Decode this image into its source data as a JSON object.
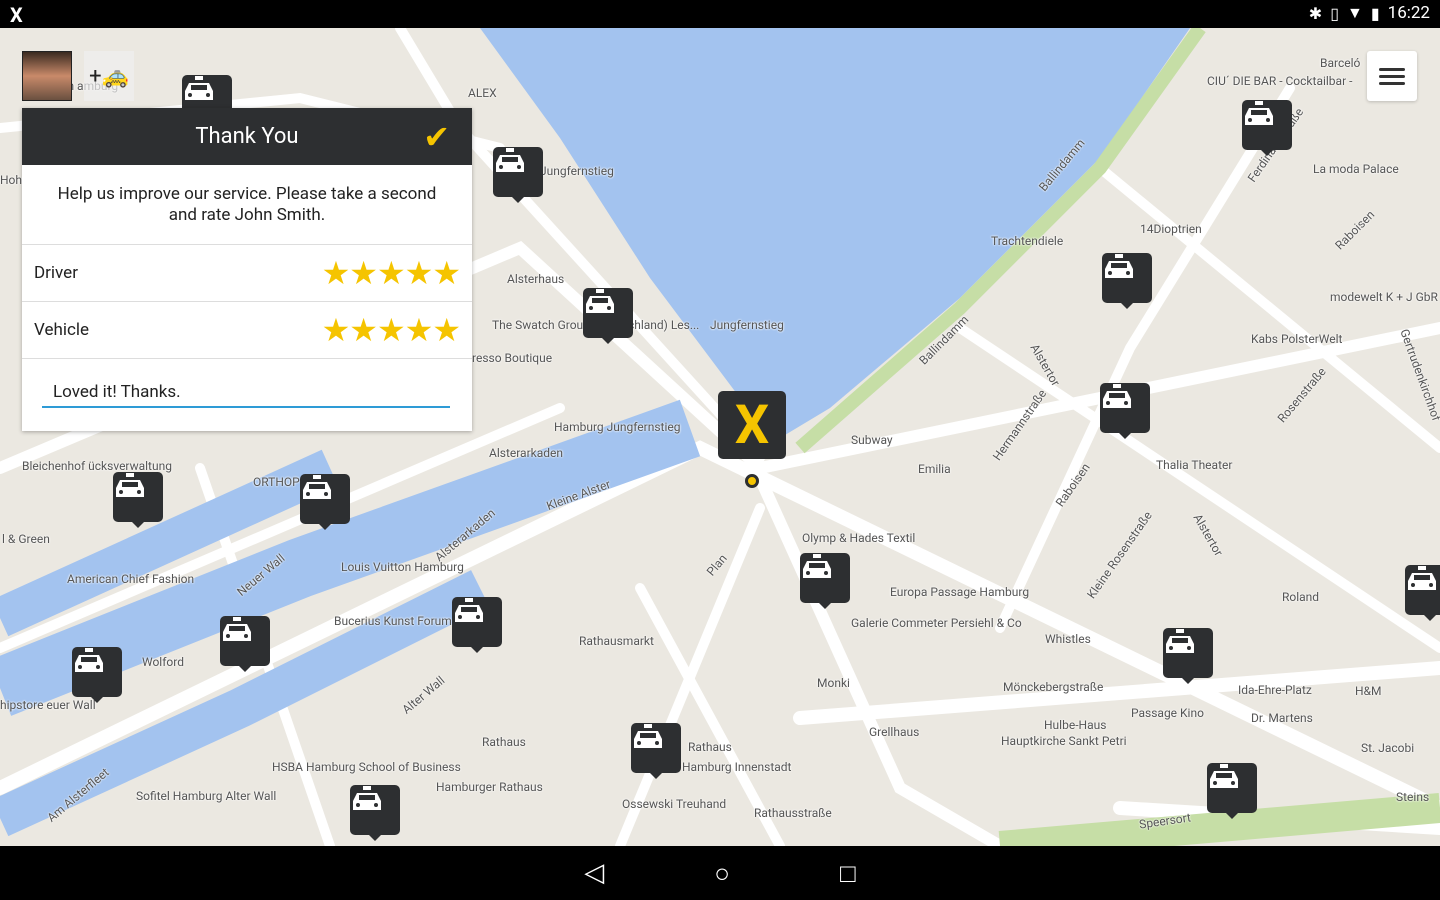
{
  "status_bar": {
    "app_icon": "mytaxi-x-icon",
    "icons": [
      "bluetooth-icon",
      "vibrate-icon",
      "wifi-icon",
      "battery-icon"
    ],
    "time": "16:22"
  },
  "rating_dialog": {
    "title": "Thank You",
    "confirm_icon": "checkmark-icon",
    "message": "Help us improve our service. Please take a second and rate John Smith.",
    "ratings": [
      {
        "label": "Driver",
        "stars": 5,
        "max": 5,
        "display": "★★★★★"
      },
      {
        "label": "Vehicle",
        "stars": 5,
        "max": 5,
        "display": "★★★★★"
      }
    ],
    "comment_value": "Loved it! Thanks."
  },
  "toolbar": {
    "add_taxi_label": "+🚕",
    "menu_icon": "hamburger-menu-icon"
  },
  "colors": {
    "accent": "#f5c400",
    "dark": "#2d2f31",
    "water": "#a3c3ef",
    "land": "#ebe8e1",
    "input_underline": "#2e9bd6"
  },
  "map": {
    "labels": [
      "ALEX",
      "Jungfernstieg",
      "Alsterhaus",
      "The Swatch Group (Deutschland) Les...",
      "resso Boutique",
      "Jungfernstieg",
      "Hamburg Jungfernstieg",
      "Alsterarkaden",
      "Kleine Alster",
      "Alsterarkaden",
      "Louis Vuitton Hamburg",
      "Bucerius Kunst Forum",
      "Neuer Wall",
      "Rathausmarkt",
      "Rathaus",
      "Hamburger Rathaus",
      "HSBA Hamburg School of Business",
      "Alter Wall",
      "Am Alsterfleet",
      "Sofitel Hamburg Alter Wall",
      "Wolford",
      "American Chief Fashion",
      "l & Green",
      "Bleichenhof ücksverwaltung",
      "hipstore euer Wall",
      "ORTHOP NEUE",
      "Rathaus",
      "Hamburg Innenstadt",
      "Ossewski Treuhand",
      "Rathausstraße",
      "Plan",
      "Subway",
      "Emilia",
      "Olymp & Hades Textil",
      "Europa Passage Hamburg",
      "Galerie Commeter Persiehl & Co",
      "Monki",
      "Grellhaus",
      "Mönckebergstraße",
      "Hulbe-Haus",
      "Hauptkirche Sankt Petri",
      "Passage Kino",
      "Dr. Martens",
      "Ida-Ehre-Platz",
      "H&M",
      "St. Jacobi",
      "Steins",
      "Speersort",
      "Whistles",
      "Roland",
      "Kleine Rosenstraße",
      "Alstertor",
      "Raboisen",
      "Thalia Theater",
      "Hermannstraße",
      "Alstertor",
      "Ballindamm",
      "Ballindamm",
      "Trachtendiele",
      "14Dioptrien",
      "Kabs PolsterWelt",
      "Rosenstraße",
      "modewelt K + J GbR Modegeschäft",
      "Raboisen",
      "Gertrudenkirchhof",
      "La moda Palace",
      "Ferdinandstraße",
      "CIU´ DIE BAR - Cocktailbar -",
      "Barceló",
      "ng Sh amburg",
      "Hohe Bleichen"
    ]
  },
  "navbar": {
    "back": "◁",
    "home": "○",
    "recents": "□"
  }
}
